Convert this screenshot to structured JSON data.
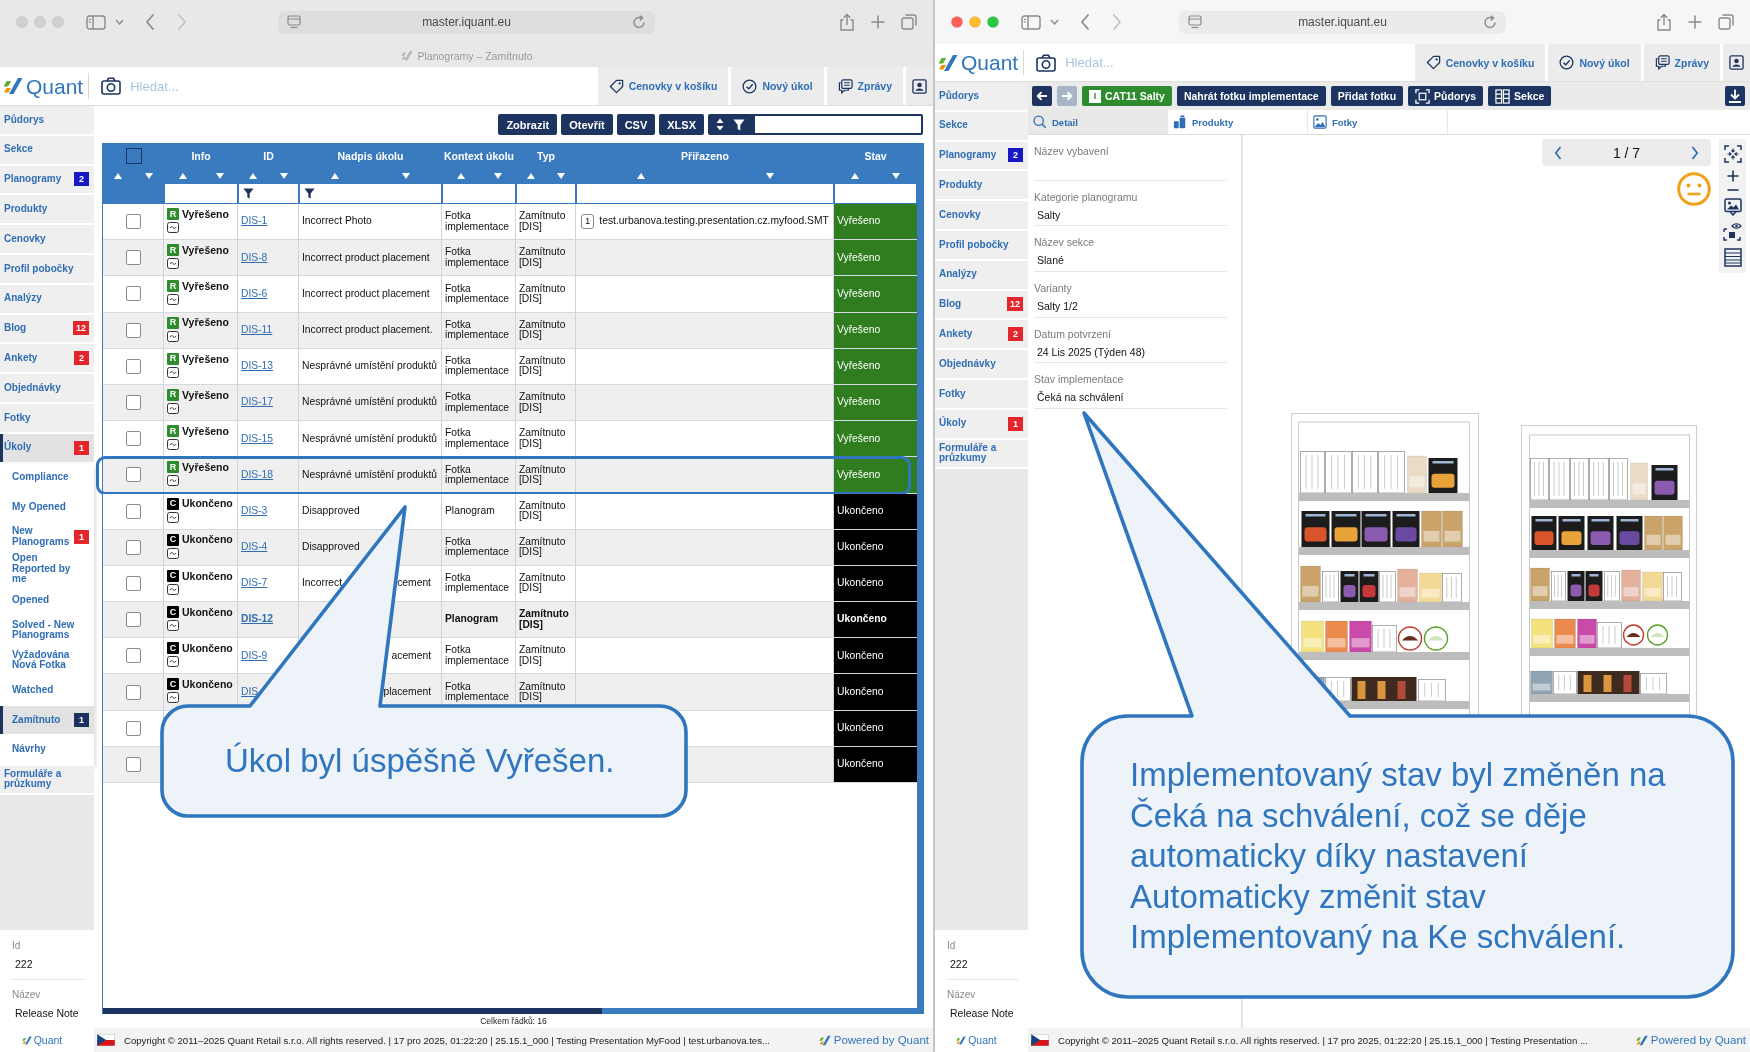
{
  "left_window": {
    "chrome": {
      "active": false,
      "url": "master.iquant.eu",
      "tab_title": "Planogramy – Zamítnuto"
    },
    "header": {
      "logo": "Quant",
      "search_placeholder": "Hledat...",
      "buttons": [
        {
          "kind": "tags",
          "label": "Cenovky v košíku"
        },
        {
          "kind": "task",
          "label": "Nový úkol"
        },
        {
          "kind": "messages",
          "label": "Zprávy"
        },
        {
          "kind": "user"
        }
      ]
    },
    "sidebar": {
      "items": [
        {
          "label": "Půdorys",
          "selected": false
        },
        {
          "label": "Sekce",
          "selected": false
        },
        {
          "label": "Planogramy",
          "selected": false,
          "badge": {
            "text": "2",
            "color": "#1717c4"
          }
        },
        {
          "label": "Produkty",
          "selected": false
        },
        {
          "label": "Cenovky",
          "selected": false
        },
        {
          "label": "Profil pobočky",
          "selected": false
        },
        {
          "label": "Analýzy",
          "selected": false
        },
        {
          "label": "Blog",
          "selected": false,
          "badge": {
            "text": "12",
            "color": "#e3262b"
          }
        },
        {
          "label": "Ankety",
          "selected": false,
          "badge": {
            "text": "2",
            "color": "#e3262b"
          }
        },
        {
          "label": "Objednávky",
          "selected": false
        },
        {
          "label": "Fotky",
          "selected": false
        },
        {
          "label": "Úkoly",
          "selected": true,
          "expanded": true,
          "badge": {
            "text": "1",
            "color": "#e3262b"
          },
          "children": [
            {
              "label": "Compliance",
              "selected": false
            },
            {
              "label": "My Opened",
              "selected": false
            },
            {
              "label": "New Planograms",
              "selected": false,
              "badge": {
                "text": "1",
                "color": "#e3262b"
              }
            },
            {
              "label": "Open Reported by me",
              "selected": false
            },
            {
              "label": "Opened",
              "selected": false
            },
            {
              "label": "Solved - New Planograms",
              "selected": false
            },
            {
              "label": "Vyžadována Nová Fotka",
              "selected": false
            },
            {
              "label": "Watched",
              "selected": false
            },
            {
              "label": "Zamítnuto",
              "selected": true,
              "badge": {
                "text": "1",
                "color": "#1d2f5e"
              }
            },
            {
              "label": "Návrhy",
              "selected": false
            }
          ]
        },
        {
          "label": "Formuláře a průzkumy",
          "selected": false
        }
      ],
      "info": [
        {
          "label": "Id",
          "value": "222"
        },
        {
          "label": "Název",
          "value": "Release Note"
        }
      ],
      "logo": "Quant"
    },
    "toolbar": {
      "buttons": [
        "Zobrazit",
        "Otevřít",
        "CSV",
        "XLSX"
      ]
    },
    "table": {
      "select_all": {
        "checked": false
      },
      "columns": [
        {
          "label": "Info",
          "filter_icon": false
        },
        {
          "label": "ID",
          "filter_icon": true
        },
        {
          "label": "Nadpis úkolu",
          "filter_icon": true
        },
        {
          "label": "Kontext úkolu",
          "filter_icon": false
        },
        {
          "label": "Typ",
          "filter_icon": false
        },
        {
          "label": "Přiřazeno",
          "filter_icon": false
        },
        {
          "label": "Stav",
          "filter_icon": false
        }
      ],
      "rows": [
        {
          "checked": false,
          "kind": "resolved",
          "code": "R",
          "info": "Vyřešeno",
          "id": "DIS-1",
          "title": "Incorrect Photo",
          "context": "Fotka implementace",
          "type": "Zamítnuto [DIS]",
          "assignee_count": "1",
          "assignee": "test.urbanova.testing.presentation.cz.myfood.SMT",
          "status": "Vyřešeno",
          "bold": false,
          "highlighted": false
        },
        {
          "checked": false,
          "kind": "resolved",
          "code": "R",
          "info": "Vyřešeno",
          "id": "DIS-8",
          "title": "Incorrect product placement",
          "context": "Fotka implementace",
          "type": "Zamítnuto [DIS]",
          "status": "Vyřešeno",
          "bold": false,
          "highlighted": false
        },
        {
          "checked": false,
          "kind": "resolved",
          "code": "R",
          "info": "Vyřešeno",
          "id": "DIS-6",
          "title": "Incorrect product placement",
          "context": "Fotka implementace",
          "type": "Zamítnuto [DIS]",
          "status": "Vyřešeno",
          "bold": false,
          "highlighted": false
        },
        {
          "checked": false,
          "kind": "resolved",
          "code": "R",
          "info": "Vyřešeno",
          "id": "DIS-11",
          "title": "Incorrect product placement.",
          "context": "Fotka implementace",
          "type": "Zamítnuto [DIS]",
          "status": "Vyřešeno",
          "bold": false,
          "highlighted": false
        },
        {
          "checked": false,
          "kind": "resolved",
          "code": "R",
          "info": "Vyřešeno",
          "id": "DIS-13",
          "title": "Nesprávné umístění produktů",
          "context": "Fotka implementace",
          "type": "Zamítnuto [DIS]",
          "status": "Vyřešeno",
          "bold": false,
          "highlighted": false
        },
        {
          "checked": false,
          "kind": "resolved",
          "code": "R",
          "info": "Vyřešeno",
          "id": "DIS-17",
          "title": "Nesprávné umístění produktů",
          "context": "Fotka implementace",
          "type": "Zamítnuto [DIS]",
          "status": "Vyřešeno",
          "bold": false,
          "highlighted": false
        },
        {
          "checked": false,
          "kind": "resolved",
          "code": "R",
          "info": "Vyřešeno",
          "id": "DIS-15",
          "title": "Nesprávné umístění produktů",
          "context": "Fotka implementace",
          "type": "Zamítnuto [DIS]",
          "status": "Vyřešeno",
          "bold": false,
          "highlighted": false
        },
        {
          "checked": false,
          "kind": "resolved",
          "code": "R",
          "info": "Vyřešeno",
          "id": "DIS-18",
          "title": "Nesprávné umístění produktů",
          "context": "Fotka implementace",
          "type": "Zamítnuto [DIS]",
          "status": "Vyřešeno",
          "bold": false,
          "highlighted": true
        },
        {
          "checked": false,
          "kind": "closed",
          "code": "C",
          "info": "Ukončeno",
          "id": "DIS-3",
          "title": "Disapproved",
          "context": "Planogram",
          "type": "Zamítnuto [DIS]",
          "status": "Ukončeno",
          "bold": false,
          "highlighted": false
        },
        {
          "checked": false,
          "kind": "closed",
          "code": "C",
          "info": "Ukončeno",
          "id": "DIS-4",
          "title": "Disapproved",
          "context": "Fotka implementace",
          "type": "Zamítnuto [DIS]",
          "status": "Ukončeno",
          "bold": false,
          "highlighted": false
        },
        {
          "checked": false,
          "kind": "closed",
          "code": "C",
          "info": "Ukončeno",
          "id": "DIS-7",
          "title": "Incorrect",
          "title_end": "cement",
          "context": "Fotka implementace",
          "type": "Zamítnuto [DIS]",
          "status": "Ukončeno",
          "bold": false,
          "highlighted": false
        },
        {
          "checked": false,
          "kind": "closed",
          "code": "C",
          "info": "Ukončeno",
          "id": "DIS-12",
          "context": "Planogram",
          "type": "Zamítnuto [DIS]",
          "status": "Ukončeno",
          "bold": true,
          "highlighted": false
        },
        {
          "checked": false,
          "kind": "closed",
          "code": "C",
          "info": "Ukončeno",
          "id": "DIS-9",
          "title_end": "acement",
          "context": "Fotka implementace",
          "type": "Zamítnuto [DIS]",
          "status": "Ukončeno",
          "bold": false,
          "highlighted": false
        },
        {
          "checked": false,
          "kind": "closed",
          "code": "C",
          "info": "Ukončeno",
          "id": "DIS",
          "title_end": "placement",
          "context": "Fotka implementace",
          "type": "Zamítnuto [DIS]",
          "status": "Ukončeno",
          "bold": false,
          "highlighted": false
        },
        {
          "checked": false,
          "kind": "closed",
          "status": "Ukončeno",
          "bold": false,
          "highlighted": false
        },
        {
          "checked": false,
          "kind": "closed",
          "status": "Ukončeno",
          "bold": false,
          "highlighted": false
        }
      ],
      "total": "Celkem řádků: 16"
    },
    "footer": {
      "copyright": "Copyright © 2011–2025 Quant Retail s.r.o. All rights reserved. | 17 pro 2025, 01:22:20 | 25.15.1_000 | Testing Presentation MyFood | test.urbanova.tes...",
      "powered_by": "Powered by Quant"
    },
    "callout": {
      "text": "Úkol byl úspěšně Vyřešen."
    }
  },
  "right_window": {
    "chrome": {
      "active": true,
      "url": "master.iquant.eu"
    },
    "header": {
      "logo": "Quant",
      "search_placeholder": "Hledat...",
      "buttons": [
        {
          "kind": "tags",
          "label": "Cenovky v košíku"
        },
        {
          "kind": "task",
          "label": "Nový úkol"
        },
        {
          "kind": "messages",
          "label": "Zprávy"
        },
        {
          "kind": "user"
        }
      ]
    },
    "sidebar": {
      "items": [
        {
          "label": "Půdorys",
          "selected": false
        },
        {
          "label": "Sekce",
          "selected": false
        },
        {
          "label": "Planogramy",
          "selected": false,
          "badge": {
            "text": "2",
            "color": "#1717c4"
          }
        },
        {
          "label": "Produkty",
          "selected": false
        },
        {
          "label": "Cenovky",
          "selected": false
        },
        {
          "label": "Profil pobočky",
          "selected": false
        },
        {
          "label": "Analýzy",
          "selected": false
        },
        {
          "label": "Blog",
          "selected": false,
          "badge": {
            "text": "12",
            "color": "#e3262b"
          }
        },
        {
          "label": "Ankety",
          "selected": false,
          "badge": {
            "text": "2",
            "color": "#e3262b"
          }
        },
        {
          "label": "Objednávky",
          "selected": false
        },
        {
          "label": "Fotky",
          "selected": false
        },
        {
          "label": "Úkoly",
          "selected": false,
          "badge": {
            "text": "1",
            "color": "#e3262b"
          }
        },
        {
          "label": "Formuláře a průzkumy",
          "selected": false
        }
      ],
      "info": [
        {
          "label": "Id",
          "value": "222"
        },
        {
          "label": "Název",
          "value": "Release Note"
        }
      ],
      "logo": "Quant"
    },
    "toolbar": [
      {
        "kind": "back",
        "disabled": false
      },
      {
        "kind": "forward",
        "disabled": true
      },
      {
        "kind": "category",
        "badge": "I",
        "label": "CAT11 Salty"
      },
      {
        "kind": "action",
        "label": "Nahrát fotku implementace"
      },
      {
        "kind": "action",
        "label": "Přidat fotku"
      },
      {
        "kind": "floorplan",
        "label": "Půdorys"
      },
      {
        "kind": "sections",
        "label": "Sekce"
      },
      {
        "kind": "download"
      }
    ],
    "tabs": [
      {
        "kind": "detail",
        "label": "Detail",
        "selected": true
      },
      {
        "kind": "products",
        "label": "Produkty",
        "selected": false
      },
      {
        "kind": "photos",
        "label": "Fotky",
        "selected": false
      }
    ],
    "details": [
      {
        "label": "Název vybavení"
      },
      {
        "label": "Kategorie planogramu",
        "value": "Salty"
      },
      {
        "label": "Název sekce",
        "value": "Slané"
      },
      {
        "label": "Varianty",
        "value": "Salty 1/2"
      },
      {
        "label": "Datum potvrzení",
        "value": "24 Lis 2025 (Týden 48)"
      },
      {
        "label": "Stav implementace",
        "value": "Čeká na schválení"
      }
    ],
    "viewer": {
      "pager": "1 / 7"
    },
    "footer": {
      "copyright": "Copyright © 2011–2025 Quant Retail s.r.o. All rights reserved. | 17 pro 2025, 01:22:20 | 25.15.1_000 | Testing Presentation ...",
      "powered_by": "Powered by Quant"
    },
    "callout": {
      "text": "Implementovaný stav byl změněn na Čeká na schválení, což se děje automaticky díky nastavení Automaticky změnit stav Implementovaný na Ke schválení."
    }
  }
}
